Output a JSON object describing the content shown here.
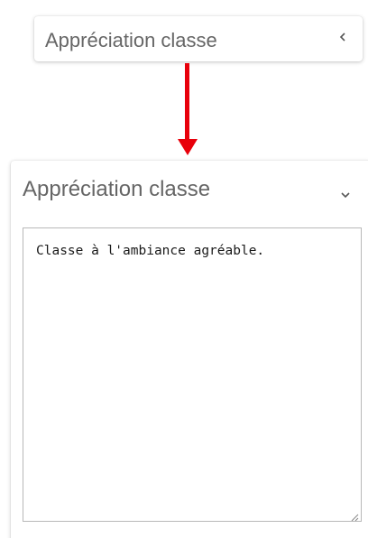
{
  "collapsed_panel": {
    "title": "Appréciation classe",
    "chevron_icon": "chevron-left-icon"
  },
  "arrow": {
    "color": "#e8000b",
    "icon": "arrow-down-icon"
  },
  "expanded_panel": {
    "title": "Appréciation classe",
    "chevron_icon": "chevron-down-icon",
    "textarea_value": "Classe à l'ambiance agréable."
  }
}
